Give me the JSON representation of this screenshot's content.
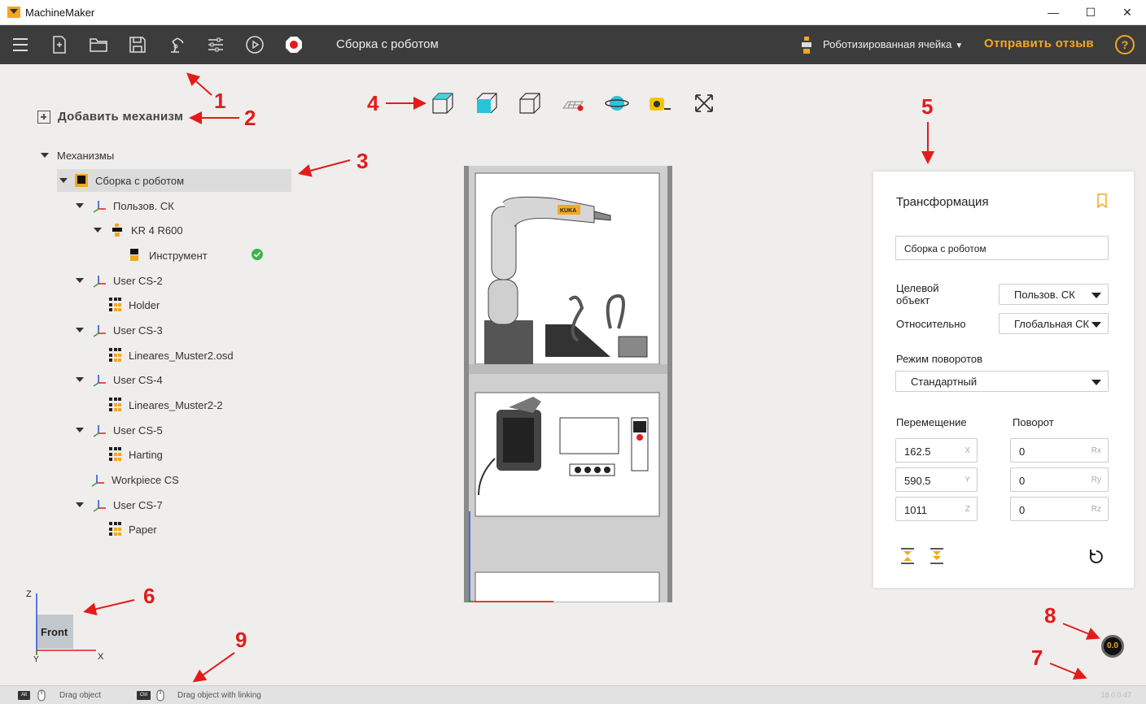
{
  "window": {
    "title": "MachineMaker",
    "minimize": "—",
    "maximize": "☐",
    "close": "✕"
  },
  "toolbar": {
    "document_title": "Сборка с роботом",
    "cell_selector": "Роботизированная ячейка",
    "feedback": "Отправить отзыв",
    "help": "?"
  },
  "sidebar": {
    "add_mechanism": "Добавить механизм",
    "root_label": "Механизмы",
    "items": [
      {
        "label": "Сборка с роботом",
        "icon": "assembly-icon"
      },
      {
        "label": "Пользов. СК",
        "icon": "coordinate-system-icon"
      },
      {
        "label": "KR 4 R600",
        "icon": "robot-icon"
      },
      {
        "label": "Инструмент",
        "icon": "tool-icon"
      },
      {
        "label": "User CS-2",
        "icon": "coordinate-system-icon"
      },
      {
        "label": "Holder",
        "icon": "part-icon"
      },
      {
        "label": "User CS-3",
        "icon": "coordinate-system-icon"
      },
      {
        "label": "Lineares_Muster2.osd",
        "icon": "part-icon"
      },
      {
        "label": "User CS-4",
        "icon": "coordinate-system-icon"
      },
      {
        "label": "Lineares_Muster2-2",
        "icon": "part-icon"
      },
      {
        "label": "User CS-5",
        "icon": "coordinate-system-icon"
      },
      {
        "label": "Harting",
        "icon": "part-icon"
      },
      {
        "label": "Workpiece CS",
        "icon": "coordinate-system-icon"
      },
      {
        "label": "User CS-7",
        "icon": "coordinate-system-icon"
      },
      {
        "label": "Paper",
        "icon": "part-icon"
      }
    ]
  },
  "viewport": {
    "robot_brand": "KUKA",
    "orientation": {
      "face": "Front",
      "axis_z": "Z",
      "axis_x": "X",
      "axis_y": "Y"
    },
    "gauge": "0.0"
  },
  "annotations": [
    "1",
    "2",
    "3",
    "4",
    "5",
    "6",
    "7",
    "8",
    "9"
  ],
  "transform_panel": {
    "title": "Трансформация",
    "name_value": "Сборка с роботом",
    "target_label": "Целевой объект",
    "target_value": "Пользов. СК",
    "relative_label": "Относительно",
    "relative_value": "Глобальная СК",
    "rotation_mode_label": "Режим поворотов",
    "rotation_mode_value": "Стандартный",
    "translation_label": "Перемещение",
    "rotation_label": "Поворот",
    "x": "162.5",
    "y": "590.5",
    "z": "1011",
    "rx": "0",
    "ry": "0",
    "rz": "0",
    "ax_x": "X",
    "ax_y": "Y",
    "ax_z": "Z",
    "ax_rx": "Rx",
    "ax_ry": "Ry",
    "ax_rz": "Rz"
  },
  "statusbar": {
    "key1": "Alt",
    "drag": "Drag object",
    "key2": "Ctrl",
    "drag_link": "Drag object with linking",
    "version": "18.0.0.47"
  },
  "colors": {
    "accent": "#f5a623",
    "toolbar": "#3c3c3c",
    "annotation": "#e31b1b",
    "cyan": "#29c4d8"
  }
}
